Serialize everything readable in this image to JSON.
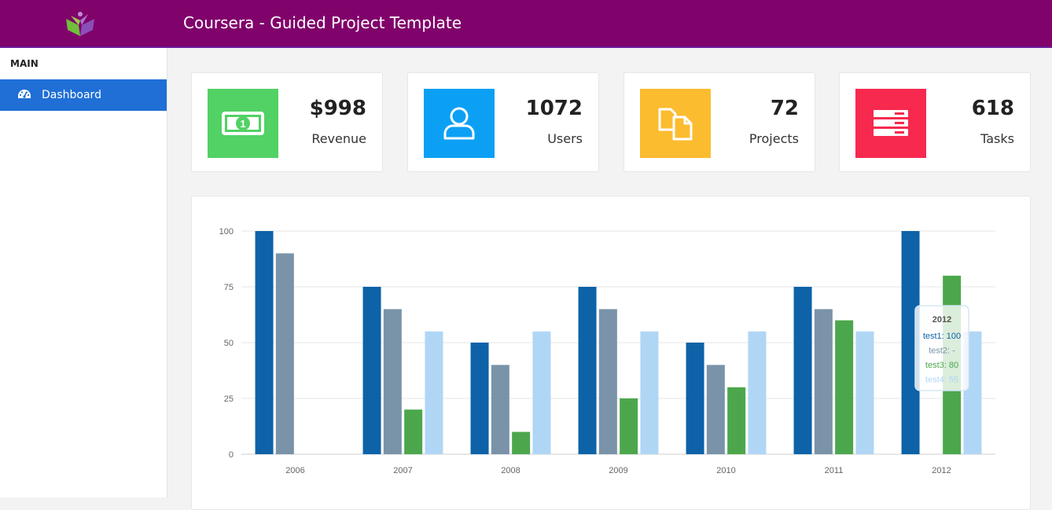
{
  "header": {
    "title": "Coursera - Guided Project Template",
    "logo": "book-logo"
  },
  "sidebar": {
    "heading": "MAIN",
    "items": [
      {
        "label": "Dashboard",
        "icon": "dashboard-gauge-icon",
        "active": true
      }
    ]
  },
  "cards": [
    {
      "value": "$998",
      "label": "Revenue",
      "icon": "money-bill-icon",
      "color": "#52d165"
    },
    {
      "value": "1072",
      "label": "Users",
      "icon": "user-icon",
      "color": "#0ca0f5"
    },
    {
      "value": "72",
      "label": "Projects",
      "icon": "copy-files-icon",
      "color": "#fcbc30"
    },
    {
      "value": "618",
      "label": "Tasks",
      "icon": "server-stack-icon",
      "color": "#f7294f"
    }
  ],
  "chart_data": {
    "type": "bar",
    "categories": [
      "2006",
      "2007",
      "2008",
      "2009",
      "2010",
      "2011",
      "2012"
    ],
    "yticks": [
      "0",
      "25",
      "50",
      "75",
      "100"
    ],
    "ylim": [
      0,
      100
    ],
    "grid": true,
    "series": [
      {
        "name": "test1",
        "color": "#0d62a8",
        "values": [
          100,
          75,
          50,
          75,
          50,
          75,
          100
        ]
      },
      {
        "name": "test2",
        "color": "#7a93a8",
        "values": [
          90,
          65,
          40,
          65,
          40,
          65,
          null
        ]
      },
      {
        "name": "test3",
        "color": "#4ca74c",
        "values": [
          null,
          20,
          10,
          25,
          30,
          60,
          80
        ]
      },
      {
        "name": "test4",
        "color": "#b0d6f6",
        "values": [
          null,
          55,
          55,
          55,
          55,
          55,
          55
        ]
      }
    ],
    "tooltip": {
      "title": "2012",
      "lines": [
        "test1: 100",
        "test2: -",
        "test3: 80",
        "test4: 55"
      ]
    }
  }
}
